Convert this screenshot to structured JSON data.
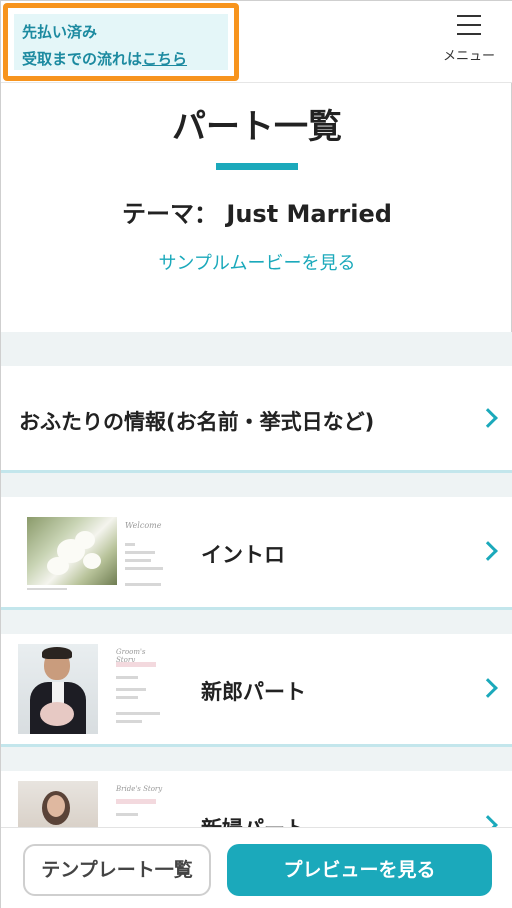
{
  "header": {
    "notice_line1": "先払い済み",
    "notice_line2_prefix": "受取までの流れは",
    "notice_link": "こちら",
    "menu_label": "メニュー"
  },
  "page": {
    "title": "パート一覧",
    "theme_label": "テーマ：",
    "theme_name": "Just Married",
    "sample_link": "サンプルムービーを見る"
  },
  "parts": [
    {
      "label": "おふたりの情報(お名前・挙式日など)"
    },
    {
      "label": "イントロ",
      "thumb_script": "Welcome"
    },
    {
      "label": "新郎パート",
      "thumb_script": "Groom's Story"
    },
    {
      "label": "新婦パート",
      "thumb_script": "Bride's Story"
    }
  ],
  "footer": {
    "template_button": "テンプレート一覧",
    "preview_button": "プレビューを見る"
  },
  "colors": {
    "accent": "#1ba9bb",
    "notice_border": "#f7941d",
    "notice_bg": "#e4f6f8"
  }
}
